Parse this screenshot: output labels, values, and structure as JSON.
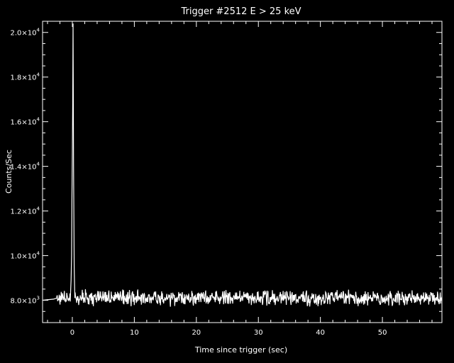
{
  "chart_data": {
    "type": "line",
    "title": "Trigger #2512  E > 25 keV",
    "xlabel": "Time since trigger (sec)",
    "ylabel": "Counts/Sec",
    "xlim": [
      -4.8,
      59.6
    ],
    "ylim": [
      7000,
      20500
    ],
    "x_ticks": [
      0,
      10,
      20,
      30,
      40,
      50
    ],
    "y_ticks": [
      {
        "value": 8000,
        "mant": "8.0",
        "base": "×10",
        "exp": "3"
      },
      {
        "value": 10000,
        "mant": "1.0",
        "base": "×10",
        "exp": "4"
      },
      {
        "value": 12000,
        "mant": "1.2",
        "base": "×10",
        "exp": "4"
      },
      {
        "value": 14000,
        "mant": "1.4",
        "base": "×10",
        "exp": "4"
      },
      {
        "value": 16000,
        "mant": "1.6",
        "base": "×10",
        "exp": "4"
      },
      {
        "value": 18000,
        "mant": "1.8",
        "base": "×10",
        "exp": "4"
      },
      {
        "value": 20000,
        "mant": "2.0",
        "base": "×10",
        "exp": "4"
      }
    ],
    "series": [
      {
        "color": "#ffffff",
        "pre_trigger_points": [
          [
            -4.8,
            8000
          ],
          [
            -3.0,
            8050
          ],
          [
            -2.5,
            8100
          ]
        ],
        "burst_points": [
          [
            -0.3,
            8200
          ],
          [
            -0.2,
            8900
          ],
          [
            -0.12,
            10000
          ],
          [
            -0.06,
            12500
          ],
          [
            0.0,
            14600
          ],
          [
            0.06,
            16800
          ],
          [
            0.12,
            20400
          ],
          [
            0.2,
            14000
          ],
          [
            0.3,
            9500
          ],
          [
            0.4,
            8100
          ]
        ],
        "background_level": 8100,
        "noise_amplitude": 400,
        "sample_interval": 0.064,
        "x_range": [
          -2.5,
          59.6
        ]
      }
    ]
  }
}
